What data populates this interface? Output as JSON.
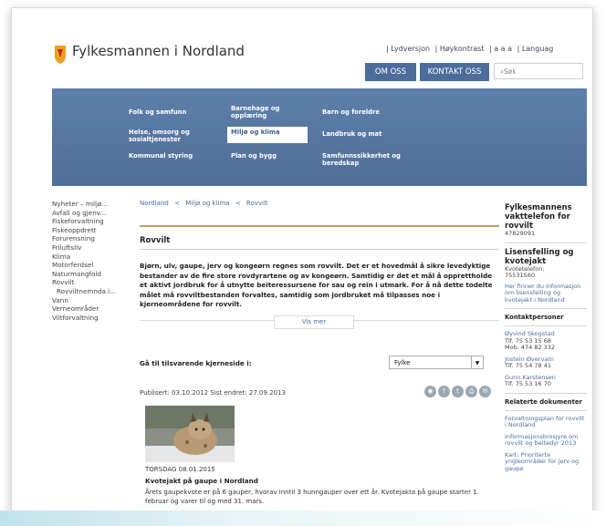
{
  "header": {
    "site_title": "Fylkesmannen i Nordland",
    "toplinks": [
      "| Lydversjon",
      "| Høykontrast",
      "| a a a",
      "| Languag"
    ],
    "btn_om_oss": "OM OSS",
    "btn_kontakt": "KONTAKT OSS",
    "search_placeholder": "Søk"
  },
  "nav": {
    "items": [
      "Folk og samfunn",
      "Barnehage og opplæring",
      "Barn og foreldre",
      "Helse, omsorg og sosialtjenester",
      "Miljø og klima",
      "Landbruk og mat",
      "Kommunal styring",
      "Plan og bygg",
      "Samfunnssikkerhet og beredskap"
    ]
  },
  "left_menu": [
    "Nyheter – miljø...",
    "Avfall og gjenv...",
    "Fiskeforvaltning",
    "Fiskeoppdrett",
    "Forurensning",
    "Friluftsliv",
    "Klima",
    "Motorferdsel",
    "Naturmangfold",
    "Rovvilt",
    "Rovviltnemnda i...",
    "Vann",
    "Verneområder",
    "Viltforvaltning"
  ],
  "breadcrumb": [
    "Nordland",
    "<",
    "Miljø og klima",
    "<",
    "Rovvilt"
  ],
  "main": {
    "title": "Rovvilt",
    "intro": "Bjørn, ulv, gaupe, jerv og kongeørn regnes som rovvilt. Det er et hovedmål å sikre levedyktige bestander av de fire store rovdyrartene og av kongeørn. Samtidig er det et mål å opprettholde et aktivt jordbruk for å utnytte beiteressursene for sau og rein i utmark. For å nå dette todelte målet må rovviltbestanden forvaltes, samtidig som jordbruket må tilpasses noe i kjerneområdene for rovvilt.",
    "vis_mer": "Vis mer",
    "goto_label": "Gå til tilsvarende kjerneside i:",
    "select_value": "Fylke",
    "published": "Publisert: 03.10.2012 Sist endret: 27.09.2013"
  },
  "news": {
    "date": "TORSDAG 08.01.2015",
    "title": "Kvotejakt på gaupe i Nordland",
    "text": "Årets gaupekvote er på 6 gauper, hvorav inntil 3 hunngauper over ett år. Kvotejakta på gaupe starter 1. februar og varer til og med 31. mars."
  },
  "right": {
    "vakttelefon_title": "Fylkesmannens vakttelefon for rovvilt",
    "vakttelefon_number": "47829091",
    "lisens_title": "Lisensfelling og kvotejakt",
    "kvotetelefon_label": "Kvotetelefon:",
    "kvotetelefon_number": "75531560",
    "lisens_link": "Her finner du informasjon om lisensfelling og kvotejakt i Nordland",
    "kontakt_title": "Kontaktpersoner",
    "contacts": [
      {
        "name": "Øyvind Skogstad",
        "tlf": "Tlf. 75 53 15 68",
        "mob": "Mob. 474 82 332"
      },
      {
        "name": "Jostein Øvervatn",
        "tlf": "Tlf. 75 54 78 41"
      },
      {
        "name": "Gunn Karstensen",
        "tlf": "Tlf. 75 53 16 70"
      }
    ],
    "relaterte_title": "Relaterte dokumenter",
    "docs": [
      "Forvaltningsplan for rovvilt i Nordland",
      "Informasjonsbrosjyre om rovvilt og beitedyr 2013",
      "Kart: Prioriterte yngleområder for jerv og gaupe"
    ]
  },
  "colors": {
    "nav": "#5a7aa6",
    "accent_rule": "#c29a6c",
    "link": "#4c6d9b"
  }
}
